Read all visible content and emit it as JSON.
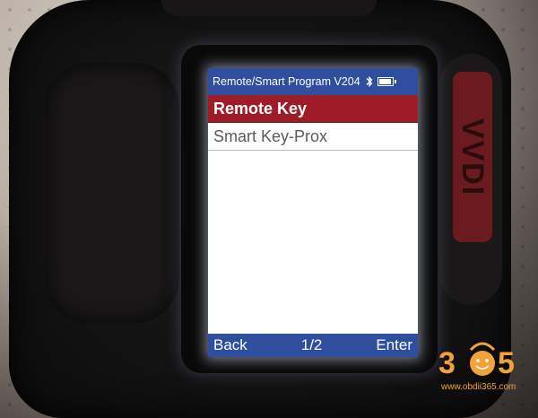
{
  "device": {
    "brand": "VVDI"
  },
  "screen": {
    "title": "Remote/Smart Program V204",
    "status_icons": [
      "bluetooth-icon",
      "battery-icon"
    ],
    "battery_level": 1.0,
    "menu_items": [
      {
        "label": "Remote Key",
        "selected": true
      },
      {
        "label": "Smart Key-Prox",
        "selected": false
      }
    ],
    "bottom_bar": {
      "left": "Back",
      "center": "1/2",
      "right": "Enter"
    }
  },
  "watermark": {
    "logo_text": "365",
    "url": "www.obdii365.com"
  },
  "colors": {
    "title_bar": "#2f4f9e",
    "selected_item": "#9e1c28",
    "brand_strip": "#6b1a1d",
    "logo_orange": "#f2a23a"
  }
}
